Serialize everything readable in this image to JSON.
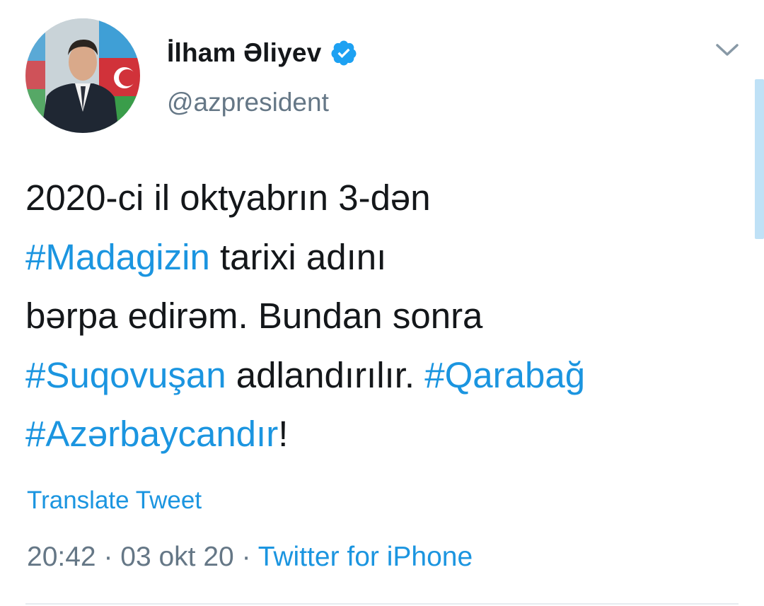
{
  "author": {
    "display_name": "İlham Əliyev",
    "handle": "@azpresident",
    "verified": true
  },
  "tweet": {
    "lines": [
      [
        {
          "text": "2020-ci il oktyabrın 3-dən",
          "hashtag": false
        }
      ],
      [
        {
          "text": "#Madagizin",
          "hashtag": true
        },
        {
          "text": " tarixi adını",
          "hashtag": false
        }
      ],
      [
        {
          "text": "bərpa edirəm. Bundan sonra",
          "hashtag": false
        }
      ],
      [
        {
          "text": "#Suqovuşan",
          "hashtag": true
        },
        {
          "text": " adlandırılır. ",
          "hashtag": false
        },
        {
          "text": "#Qarabağ",
          "hashtag": true
        }
      ],
      [
        {
          "text": "#Azərbaycandır",
          "hashtag": true
        },
        {
          "text": "!",
          "hashtag": false
        }
      ]
    ]
  },
  "translate_label": "Translate Tweet",
  "meta": {
    "time": "20:42",
    "separator": " · ",
    "date": "03 okt 20",
    "source": "Twitter for iPhone"
  },
  "icons": {
    "verified": "verified-badge-icon",
    "caret": "chevron-down-icon"
  },
  "colors": {
    "link": "#1b95e0",
    "text": "#14171a",
    "secondary": "#657786",
    "verified": "#1da1f2"
  }
}
